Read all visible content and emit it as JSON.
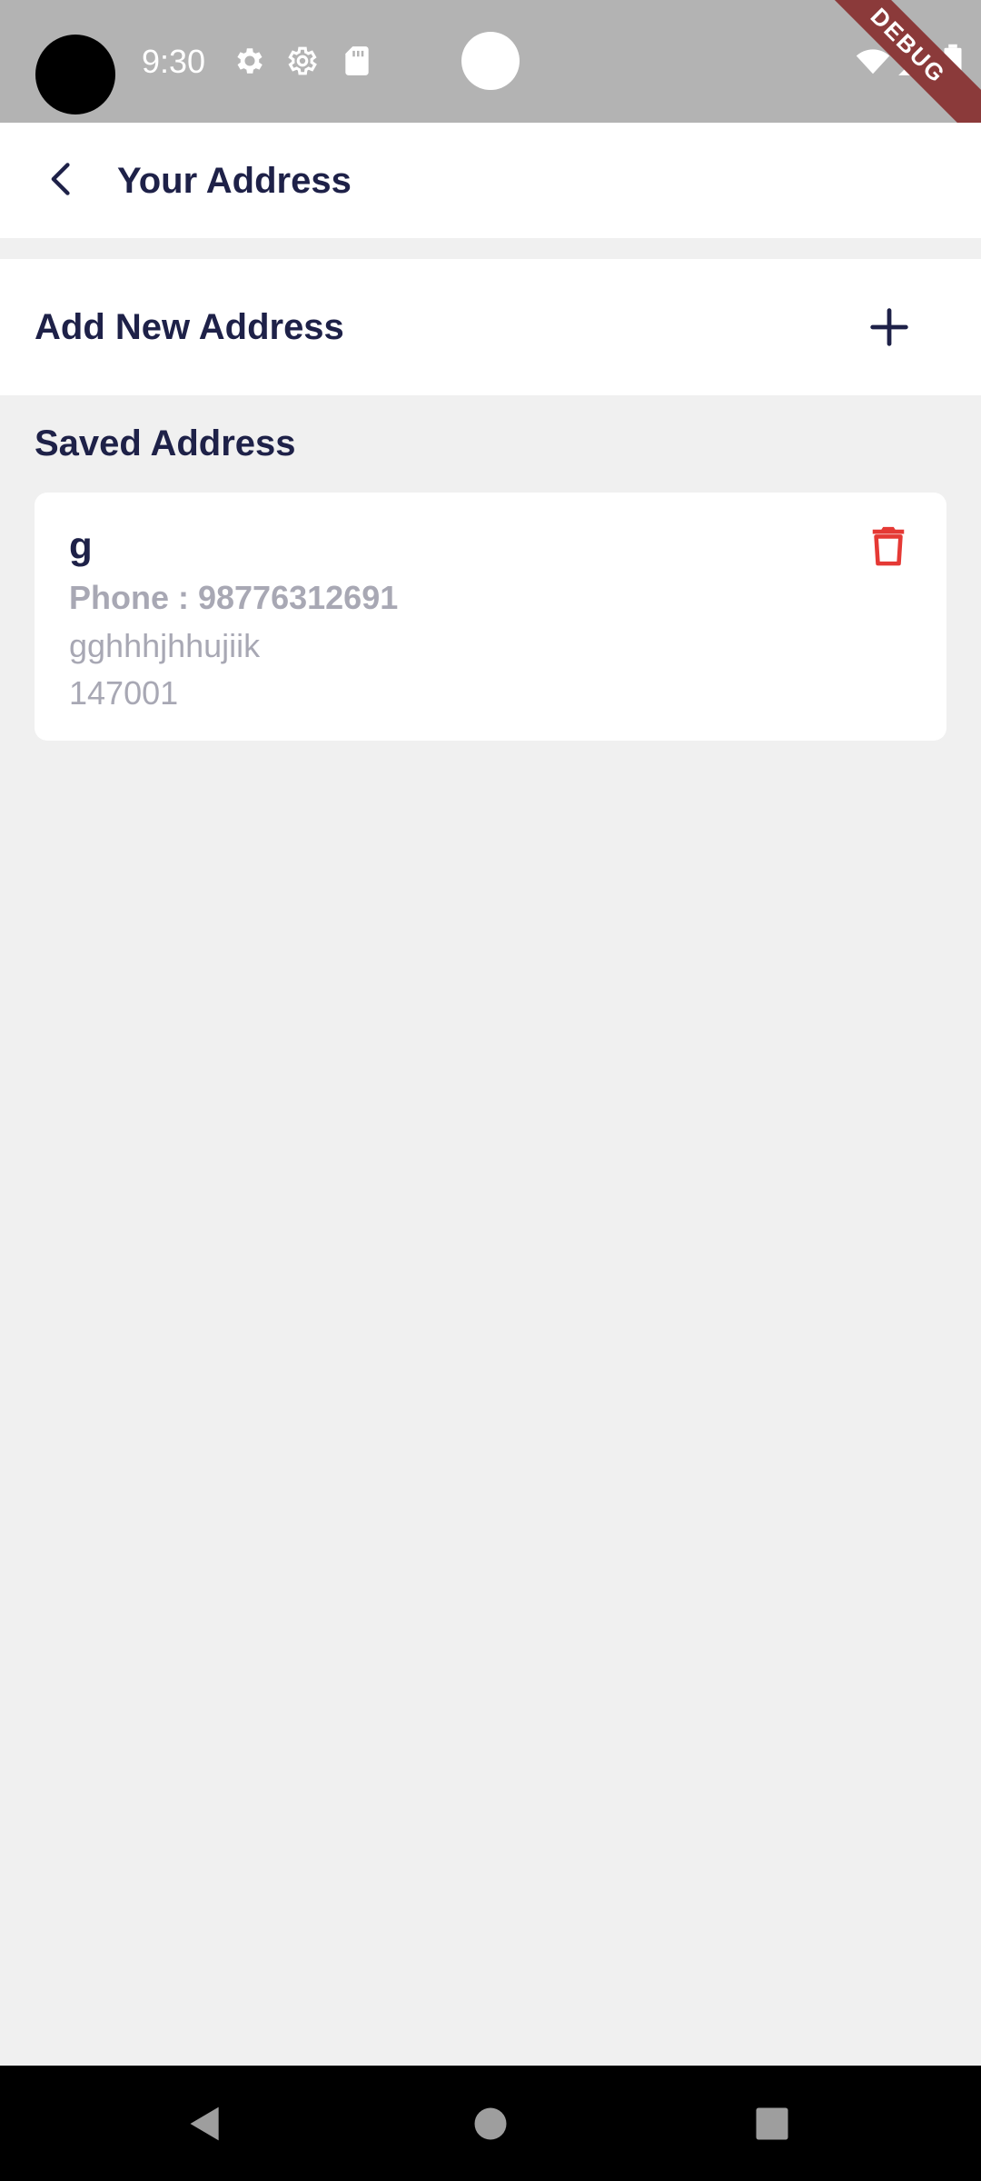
{
  "status_bar": {
    "time": "9:30",
    "icons": [
      "gear-icon",
      "settings-outline-icon",
      "sd-card-icon",
      "wifi-icon",
      "signal-icon",
      "battery-icon"
    ],
    "debug_label": "DEBUG",
    "background": "#b3b3b3"
  },
  "app_bar": {
    "back_icon": "chevron-left-icon",
    "title": "Your Address"
  },
  "add_address": {
    "label": "Add New Address",
    "icon": "plus-icon"
  },
  "saved": {
    "heading": "Saved Address",
    "addresses": [
      {
        "name": "g",
        "phone": "Phone : 98776312691",
        "line1": "gghhhjhhujiik",
        "pincode": "147001",
        "delete_icon": "trash-icon"
      }
    ]
  },
  "nav_bar": {
    "buttons": [
      "back-triangle-icon",
      "home-circle-icon",
      "recents-square-icon"
    ]
  },
  "colors": {
    "primary_text": "#1e2148",
    "secondary_text": "#a8a8b4",
    "delete": "#e53935",
    "page_background": "#f0f0f0"
  }
}
